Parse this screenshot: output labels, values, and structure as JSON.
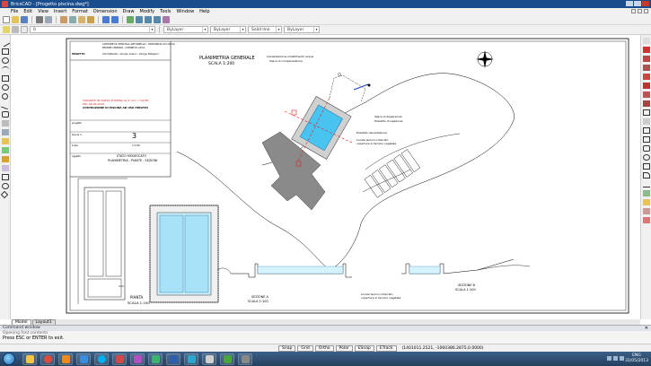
{
  "window": {
    "title": "BricsCAD - [Progetto piscina.dwg*]"
  },
  "menu": [
    "File",
    "Edit",
    "View",
    "Insert",
    "Format",
    "Dimension",
    "Draw",
    "Modify",
    "Tools",
    "Window",
    "Help"
  ],
  "properties_bar": {
    "layer": "0",
    "color": "ByLayer",
    "linetype": "ByLayer",
    "lineweight": "Solid line",
    "plotstyle": "ByLayer"
  },
  "drawing": {
    "title_block": {
      "header_line1": "COMUNE DI CERCOLA ARTURIELLO - PROVINCIA DI LUCCA",
      "header_line2": "REGIONE CAMPANIA - COMUNE DI LUCCA",
      "owner_label": "PROGETTO:",
      "owner_value": "Committente - Giorgio Grieco - Giorgio Pellegrini",
      "subject": "VARIANTE IN CORSO D'OPERA AL P. di C. n°22/83",
      "subject_line2": "DEL 06.06.2006",
      "subject_line3": "COSTRUZIONE DI PISCINA AD USO PRIVATO",
      "project_label": "progetto",
      "sheet_label": "tavola n.",
      "sheet_number": "3",
      "scale_label": "scala",
      "scale_value": "1:100",
      "status_label": "oggetto",
      "status_value": "STATO MODIFICATO",
      "drawing_name": "PLANIMETRIA - PIANTE - SEZIONI"
    },
    "planimetria_title": "PLANIMETRIA GENERALE",
    "planimetria_scale": "SCALA 1:200",
    "annotations": {
      "conduit": "Canalizzazione smaltimento acque",
      "tank": "Vasca di compensazione",
      "pump": "Vasca di dispersione",
      "inspection": "Pozzetto di ispezione",
      "decant": "Pozzetto decantazione",
      "concrete": "Locale tecnico interrato",
      "concrete2": "copertura in terreno vegetale"
    },
    "pianta_title": "PIANTA",
    "pianta_scale": "SCALA 1:100",
    "section_a_title": "SEZIONE A",
    "section_a_scale": "SCALA 1:100",
    "section_b_title": "SEZIONE B",
    "section_b_scale": "SCALA 1:100",
    "section_note": "Locale tecnico interrato",
    "section_note2": "copertura in terreno vegetale"
  },
  "layout_tabs": [
    "Model",
    "Layout1"
  ],
  "command": {
    "header": "Command window",
    "previous": "Opening font contents",
    "prompt": "Press ESC or ENTER to exit."
  },
  "status": {
    "buttons": [
      "Snap",
      "Grid",
      "Ortho",
      "Polar",
      "ESnap",
      "ETrack"
    ],
    "coords": "(1401011.2521, -1060386.2875,0.0000)"
  },
  "tray": {
    "lang": "ENG",
    "date": "31/05/2013"
  },
  "colors": {
    "titlebar": "#1a4d8c",
    "pool": "#49c3f0",
    "taskbar": "#2e4e72"
  }
}
